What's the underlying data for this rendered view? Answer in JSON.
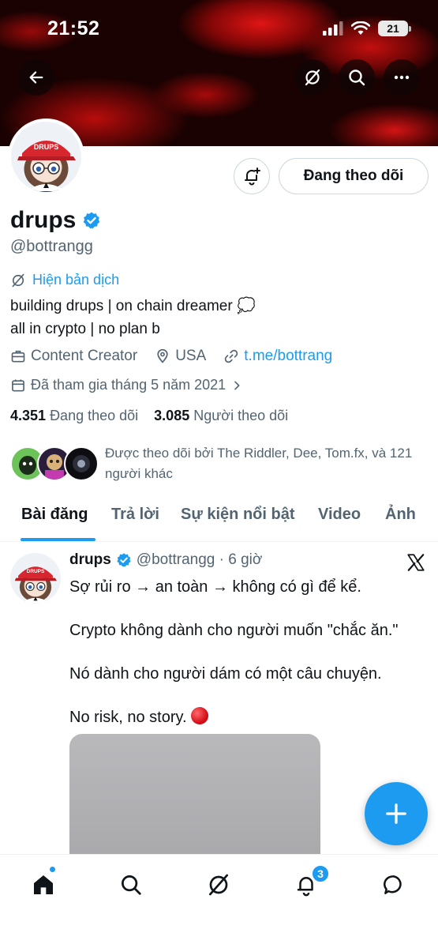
{
  "status_bar": {
    "time": "21:52",
    "battery": "21"
  },
  "profile": {
    "name": "drups",
    "handle": "@bottrangg",
    "follow_button": "Đang theo dõi",
    "translate_label": "Hiện bản dịch",
    "bio_line1": "building drups | on chain dreamer 💭",
    "bio_line2": "all in crypto | no plan b",
    "category": "Content Creator",
    "location": "USA",
    "link": "t.me/bottrang",
    "joined": "Đã tham gia tháng 5 năm 2021",
    "following_count": "4.351",
    "following_label": "Đang theo dõi",
    "followers_count": "3.085",
    "followers_label": "Người theo dõi",
    "followed_by": "Được theo dõi bởi The Riddler, Dee, Tom.fx, và 121 người khác"
  },
  "tabs": [
    "Bài đăng",
    "Trả lời",
    "Sự kiện nổi bật",
    "Video",
    "Ảnh"
  ],
  "tweet": {
    "name": "drups",
    "handle_time": "@bottrangg · 6 giờ",
    "line1": "Sợ rủi ro → an toàn → không có gì để kể.",
    "line2": "Crypto không dành cho người muốn \"chắc ăn.\"",
    "line3": "Nó dành cho người dám có một câu chuyện.",
    "line4": "No risk, no story."
  },
  "nav": {
    "notifications_badge": "3"
  },
  "colors": {
    "accent": "#1d9bf0",
    "text": "#0f1419",
    "muted": "#536471",
    "banner_red": "#c30f0f"
  },
  "icons": [
    "back-arrow-icon",
    "grok-icon",
    "search-icon",
    "more-icon",
    "bell-plus-icon",
    "verified-badge-icon",
    "translate-icon",
    "briefcase-icon",
    "location-pin-icon",
    "link-icon",
    "calendar-icon",
    "chevron-right-icon",
    "x-logo-icon",
    "plus-icon",
    "home-icon",
    "explore-icon",
    "grok-nav-icon",
    "notifications-icon",
    "messages-icon"
  ]
}
